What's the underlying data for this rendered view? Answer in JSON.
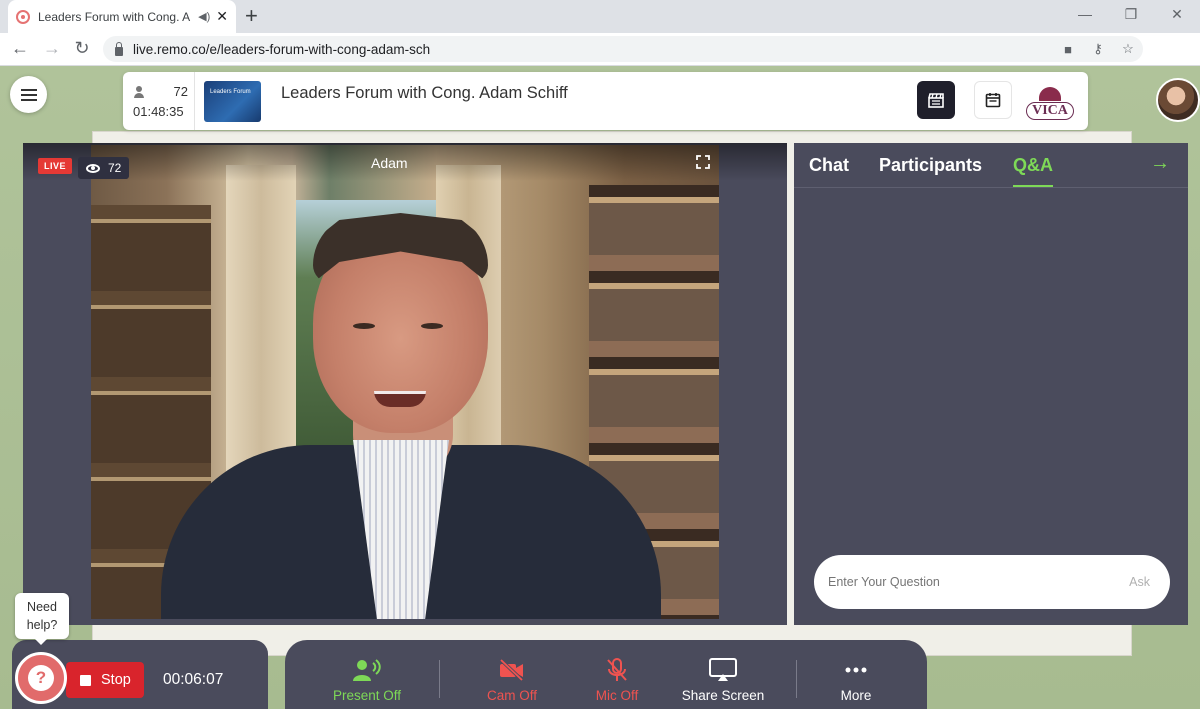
{
  "browser": {
    "tab_title": "Leaders Forum with Cong. A",
    "new_tab": "+",
    "url": "live.remo.co/e/leaders-forum-with-cong-adam-sch"
  },
  "header": {
    "attendee_count": "72",
    "elapsed_time": "01:48:35",
    "event_logo_text": "Leaders Forum",
    "event_title": "Leaders Forum with Cong. Adam Schiff",
    "sponsor_logo": "VICA"
  },
  "stage": {
    "live_label": "LIVE",
    "viewer_count": "72",
    "speaker_name": "Adam"
  },
  "panel": {
    "tabs": [
      {
        "label": "Chat",
        "active": false
      },
      {
        "label": "Participants",
        "active": false
      },
      {
        "label": "Q&A",
        "active": true
      }
    ],
    "question_placeholder": "Enter Your Question",
    "ask_label": "Ask"
  },
  "help": {
    "bubble_text": "Need help?"
  },
  "recording": {
    "stop_label": "Stop",
    "timer": "00:06:07"
  },
  "toolbar": {
    "buttons": [
      {
        "label": "Present Off",
        "icon": "present-icon",
        "color": "#7ed957"
      },
      {
        "label": "Cam Off",
        "icon": "camera-off-icon",
        "color": "#ef5350"
      },
      {
        "label": "Mic Off",
        "icon": "mic-off-icon",
        "color": "#ef5350"
      },
      {
        "label": "Share Screen",
        "icon": "share-screen-icon",
        "color": "#ffffff"
      },
      {
        "label": "More",
        "icon": "more-icon",
        "color": "#ffffff"
      }
    ]
  },
  "colors": {
    "accent_green": "#7ed957",
    "danger_red": "#d9242c",
    "panel_bg": "#4a4b5c"
  }
}
